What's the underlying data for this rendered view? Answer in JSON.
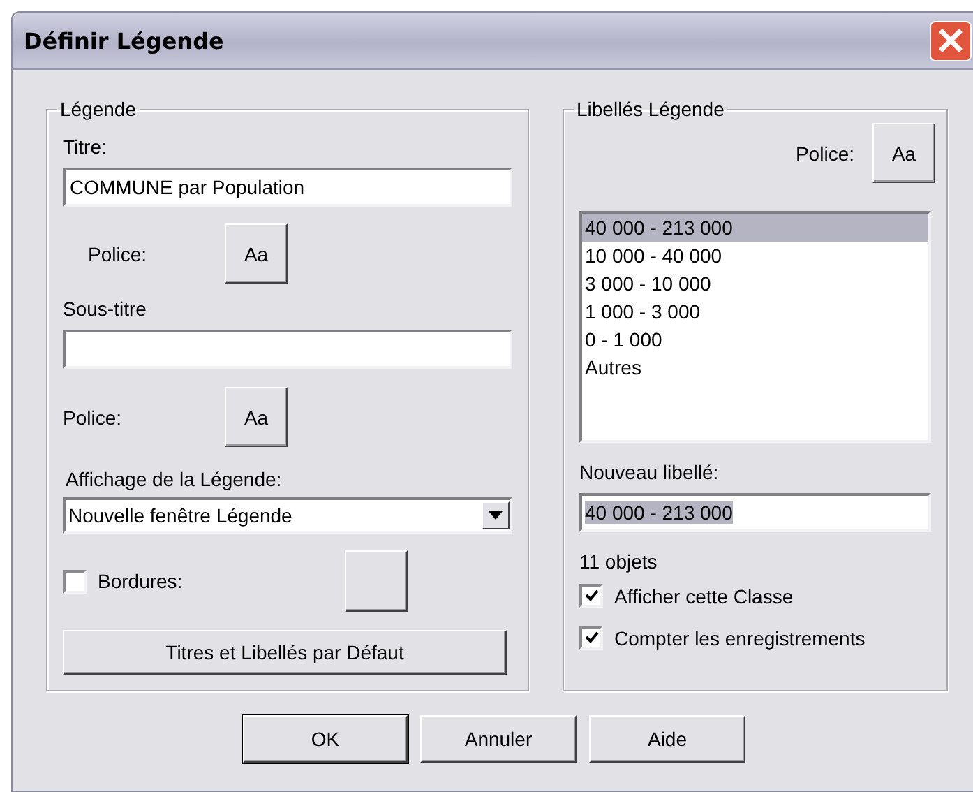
{
  "window": {
    "title": "Définir Légende"
  },
  "legend_group": {
    "title": "Légende",
    "title_label": "Titre:",
    "title_value": "COMMUNE par Population",
    "title_font_label": "Police:",
    "title_font_button": "Aa",
    "subtitle_label": "Sous-titre",
    "subtitle_font_label": "Police:",
    "subtitle_font_button": "Aa",
    "display_label": "Affichage de la Légende:",
    "display_value": "Nouvelle fenêtre Légende",
    "borders": {
      "label": "Bordures:",
      "checked": false
    },
    "default_button": "Titres et Libellés par Défaut"
  },
  "labels_group": {
    "title": "Libellés Légende",
    "font_label": "Police:",
    "font_button": "Aa",
    "items": [
      {
        "label": "40 000 - 213 000",
        "selected": true
      },
      {
        "label": "10 000 - 40 000",
        "selected": false
      },
      {
        "label": "3 000 - 10 000",
        "selected": false
      },
      {
        "label": "1 000 - 3 000",
        "selected": false
      },
      {
        "label": "0 - 1 000",
        "selected": false
      },
      {
        "label": "Autres",
        "selected": false
      }
    ],
    "new_label_label": "Nouveau libellé:",
    "new_label_value": "40 000 - 213 000",
    "count": "11 objets",
    "options": [
      {
        "label": "Afficher cette Classe",
        "checked": true
      },
      {
        "label": "Compter les enregistrements",
        "checked": true
      }
    ]
  },
  "buttons": [
    {
      "label": "OK",
      "default": true
    },
    {
      "label": "Annuler",
      "default": false
    },
    {
      "label": "Aide",
      "default": false
    }
  ]
}
